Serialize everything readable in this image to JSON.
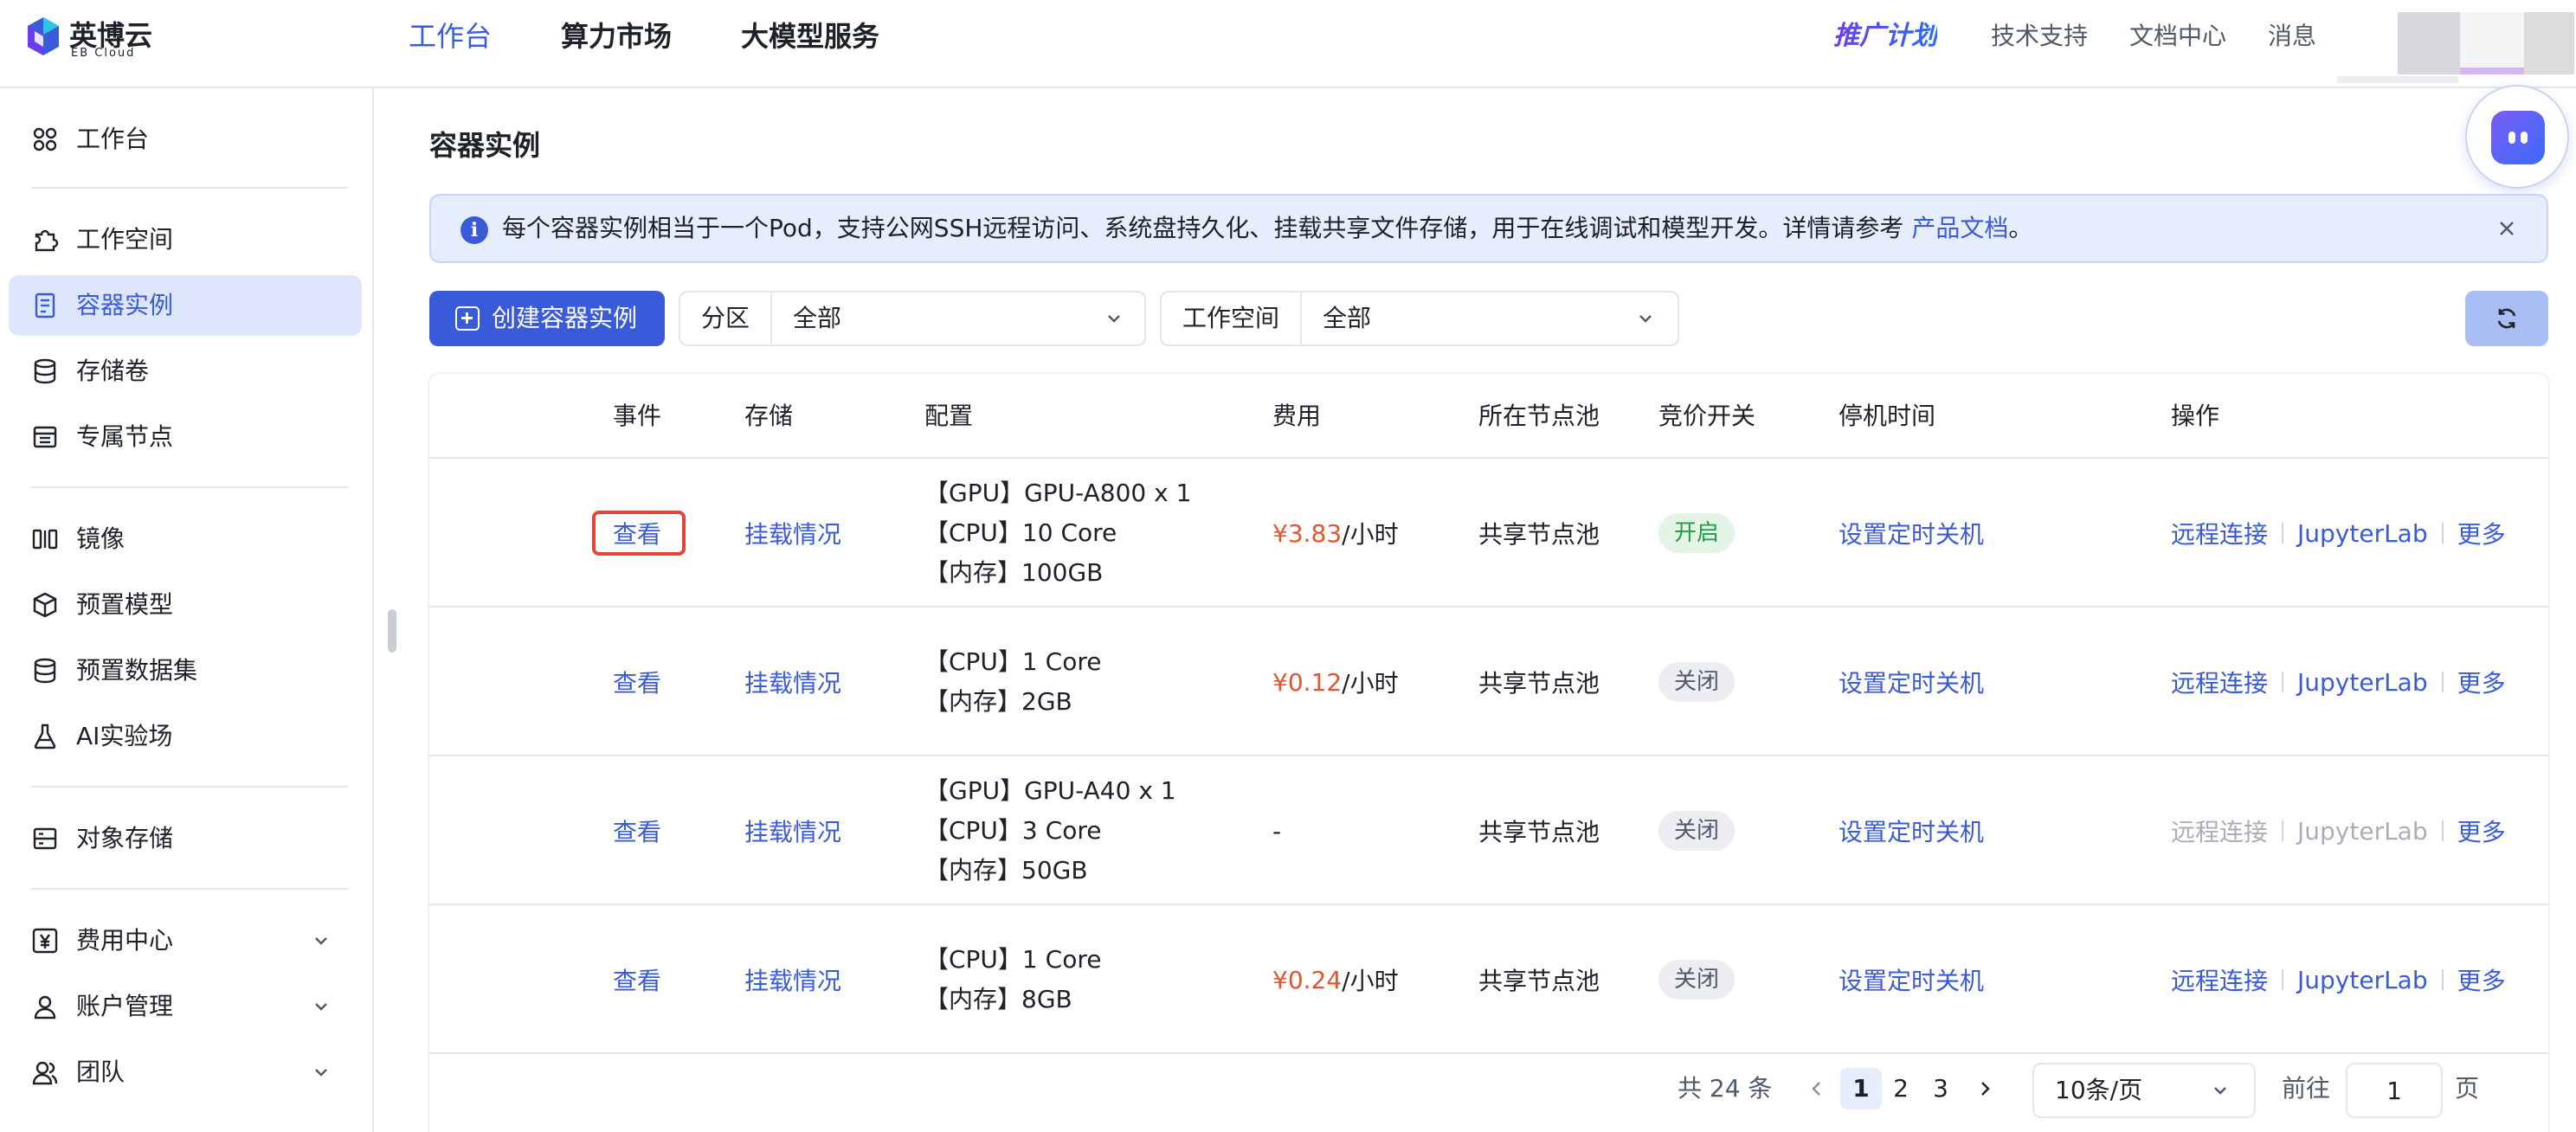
{
  "app": {
    "logo_name": "英博云",
    "logo_sub": "EB Cloud",
    "brand_color": "#3a5bd9"
  },
  "topnav": {
    "items": [
      {
        "label": "工作台",
        "active": true
      },
      {
        "label": "算力市场",
        "active": false
      },
      {
        "label": "大模型服务",
        "active": false
      }
    ],
    "promo": "推广计划",
    "links": [
      "技术支持",
      "文档中心",
      "消息"
    ]
  },
  "sidebar": {
    "items": [
      {
        "label": "工作台",
        "icon": "dashboard-icon"
      },
      {
        "label": "工作空间",
        "icon": "workspace-icon"
      },
      {
        "label": "容器实例",
        "icon": "container-icon",
        "active": true
      },
      {
        "label": "存储卷",
        "icon": "database-icon"
      },
      {
        "label": "专属节点",
        "icon": "node-icon"
      },
      {
        "label": "镜像",
        "icon": "image-icon"
      },
      {
        "label": "预置模型",
        "icon": "cube-icon"
      },
      {
        "label": "预置数据集",
        "icon": "dataset-icon"
      },
      {
        "label": "AI实验场",
        "icon": "flask-icon"
      },
      {
        "label": "对象存储",
        "icon": "storage-icon"
      },
      {
        "label": "费用中心",
        "icon": "yen-icon",
        "expandable": true
      },
      {
        "label": "账户管理",
        "icon": "user-icon",
        "expandable": true
      },
      {
        "label": "团队",
        "icon": "team-icon",
        "expandable": true
      }
    ]
  },
  "main": {
    "title": "容器实例",
    "notice": {
      "text": "每个容器实例相当于一个Pod，支持公网SSH远程访问、系统盘持久化、挂载共享文件存储，用于在线调试和模型开发。详情请参考 ",
      "link": "产品文档",
      "end": "。"
    },
    "create_button": "创建容器实例",
    "filters": [
      {
        "label": "分区",
        "value": "全部"
      },
      {
        "label": "工作空间",
        "value": "全部"
      }
    ]
  },
  "table": {
    "columns": [
      "事件",
      "存储",
      "配置",
      "费用",
      "所在节点池",
      "竞价开关",
      "停机时间",
      "操作"
    ],
    "rows": [
      {
        "event": "查看",
        "storage": "挂载情况",
        "config": [
          "【GPU】GPU-A800 x 1",
          "【CPU】10 Core",
          "【内存】100GB"
        ],
        "price": "¥3.83",
        "unit": " /小时",
        "pool": "共享节点池",
        "bid": "开启",
        "bid_on": true,
        "shutdown": "设置定时关机",
        "actions": [
          "远程连接",
          "JupyterLab",
          "更多"
        ],
        "actions_disabled": false
      },
      {
        "event": "查看",
        "storage": "挂载情况",
        "config": [
          "【CPU】1 Core",
          "【内存】2GB"
        ],
        "price": "¥0.12",
        "unit": " /小时",
        "pool": "共享节点池",
        "bid": "关闭",
        "bid_on": false,
        "shutdown": "设置定时关机",
        "actions": [
          "远程连接",
          "JupyterLab",
          "更多"
        ],
        "actions_disabled": false
      },
      {
        "event": "查看",
        "storage": "挂载情况",
        "config": [
          "【GPU】GPU-A40 x 1",
          "【CPU】3 Core",
          "【内存】50GB"
        ],
        "price": "-",
        "unit": "",
        "pool": "共享节点池",
        "bid": "关闭",
        "bid_on": false,
        "shutdown": "设置定时关机",
        "actions": [
          "远程连接",
          "JupyterLab",
          "更多"
        ],
        "actions_disabled": true
      },
      {
        "event": "查看",
        "storage": "挂载情况",
        "config": [
          "【CPU】1 Core",
          "【内存】8GB"
        ],
        "price": "¥0.24",
        "unit": " /小时",
        "pool": "共享节点池",
        "bid": "关闭",
        "bid_on": false,
        "shutdown": "设置定时关机",
        "actions": [
          "远程连接",
          "JupyterLab",
          "更多"
        ],
        "actions_disabled": false
      }
    ]
  },
  "pagination": {
    "total": "共 24 条",
    "pages": [
      "1",
      "2",
      "3"
    ],
    "current": "1",
    "page_size": "10条/页",
    "goto_label": "前往",
    "goto_value": "1",
    "page_suffix": "页"
  }
}
